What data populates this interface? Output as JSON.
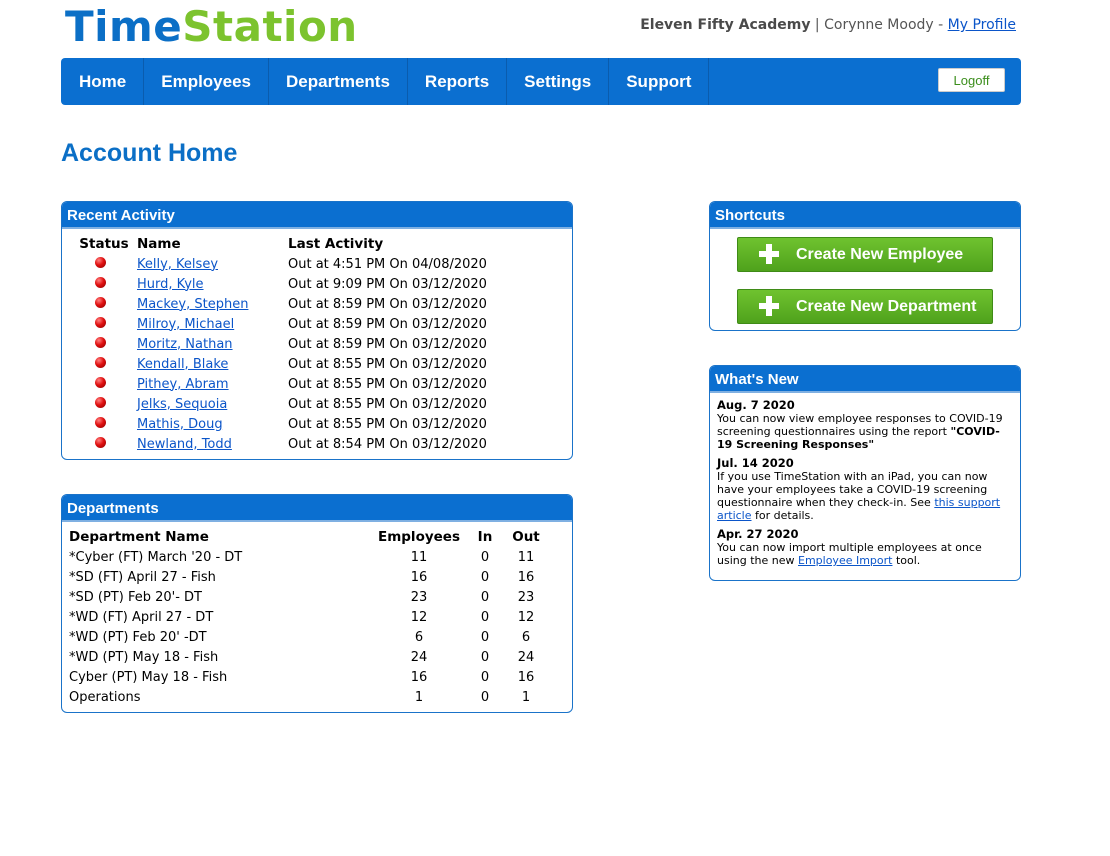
{
  "header": {
    "logo_time": "Time",
    "logo_station": "Station",
    "org": "Eleven Fifty Academy",
    "separator": " | ",
    "user": "Corynne Moody - ",
    "profile_link": "My Profile"
  },
  "nav": {
    "items": [
      "Home",
      "Employees",
      "Departments",
      "Reports",
      "Settings",
      "Support"
    ],
    "logoff": "Logoff"
  },
  "page_title": "Account Home",
  "recent_activity": {
    "title": "Recent Activity",
    "columns": [
      "Status",
      "Name",
      "Last Activity"
    ],
    "rows": [
      {
        "name": "Kelly, Kelsey",
        "activity": "Out at 4:51 PM On 04/08/2020"
      },
      {
        "name": "Hurd, Kyle",
        "activity": "Out at 9:09 PM On 03/12/2020"
      },
      {
        "name": "Mackey, Stephen",
        "activity": "Out at 8:59 PM On 03/12/2020"
      },
      {
        "name": "Milroy, Michael",
        "activity": "Out at 8:59 PM On 03/12/2020"
      },
      {
        "name": "Moritz, Nathan",
        "activity": "Out at 8:59 PM On 03/12/2020"
      },
      {
        "name": "Kendall, Blake",
        "activity": "Out at 8:55 PM On 03/12/2020"
      },
      {
        "name": "Pithey, Abram",
        "activity": "Out at 8:55 PM On 03/12/2020"
      },
      {
        "name": "Jelks, Sequoia",
        "activity": "Out at 8:55 PM On 03/12/2020"
      },
      {
        "name": "Mathis, Doug",
        "activity": "Out at 8:55 PM On 03/12/2020"
      },
      {
        "name": "Newland, Todd",
        "activity": "Out at 8:54 PM On 03/12/2020"
      }
    ]
  },
  "departments": {
    "title": "Departments",
    "columns": [
      "Department Name",
      "Employees",
      "In",
      "Out"
    ],
    "rows": [
      {
        "name": "*Cyber (FT) March '20 - DT",
        "employees": "11",
        "in": "0",
        "out": "11"
      },
      {
        "name": "*SD (FT) April 27 - Fish",
        "employees": "16",
        "in": "0",
        "out": "16"
      },
      {
        "name": "*SD (PT) Feb 20'- DT",
        "employees": "23",
        "in": "0",
        "out": "23"
      },
      {
        "name": "*WD (FT) April 27 - DT",
        "employees": "12",
        "in": "0",
        "out": "12"
      },
      {
        "name": "*WD (PT) Feb 20' -DT",
        "employees": "6",
        "in": "0",
        "out": "6"
      },
      {
        "name": "*WD (PT) May 18 - Fish",
        "employees": "24",
        "in": "0",
        "out": "24"
      },
      {
        "name": "Cyber (PT) May 18 - Fish",
        "employees": "16",
        "in": "0",
        "out": "16"
      },
      {
        "name": "Operations",
        "employees": "1",
        "in": "0",
        "out": "1"
      }
    ]
  },
  "shortcuts": {
    "title": "Shortcuts",
    "create_employee": "Create New Employee",
    "create_department": "Create New Department"
  },
  "whats_new": {
    "title": "What's New",
    "items": [
      {
        "date": "Aug. 7 2020",
        "text_before": "You can now view employee responses to COVID-19 screening questionnaires using the report ",
        "bold": "\"COVID-19 Screening Responses\"",
        "link": "",
        "text_after": ""
      },
      {
        "date": "Jul. 14 2020",
        "text_before": "If you use TimeStation with an iPad, you can now have your employees take a COVID-19 screening questionnaire when they check-in. See ",
        "bold": "",
        "link": "this support article",
        "text_after": " for details."
      },
      {
        "date": "Apr. 27 2020",
        "text_before": "You can now import multiple employees at once using the new ",
        "bold": "",
        "link": "Employee Import",
        "text_after": " tool."
      }
    ]
  },
  "colors": {
    "brand_blue": "#0b6fd0",
    "brand_green": "#7cc32e",
    "status_out": "#e01010"
  }
}
